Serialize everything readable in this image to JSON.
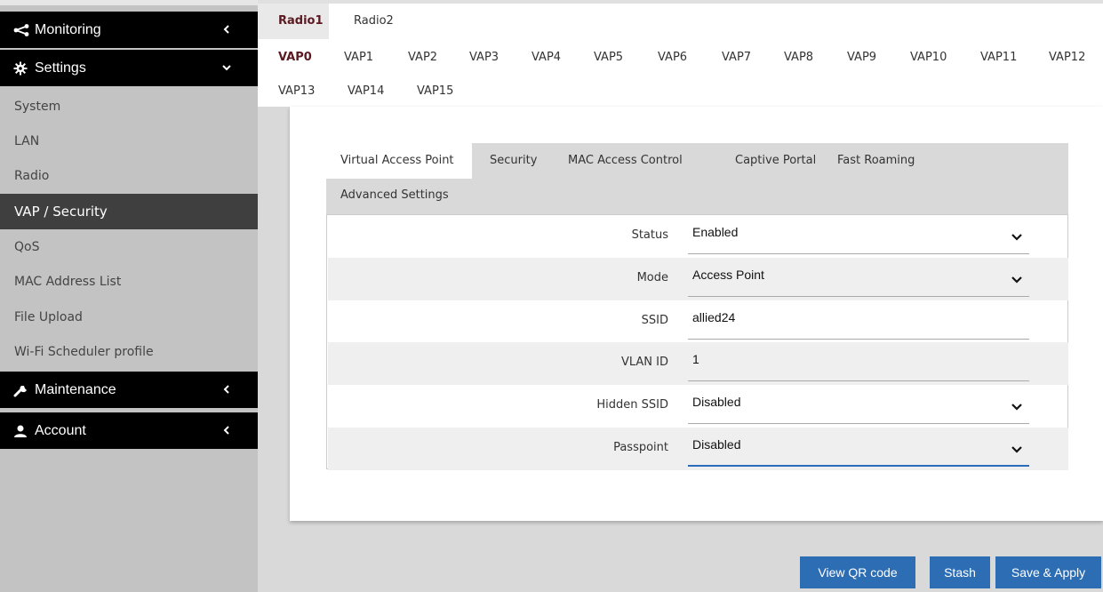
{
  "sidebar": {
    "monitoring": "Monitoring",
    "settings": "Settings",
    "items": [
      {
        "label": "System"
      },
      {
        "label": "LAN"
      },
      {
        "label": "Radio"
      },
      {
        "label": "VAP / Security"
      },
      {
        "label": "QoS"
      },
      {
        "label": "MAC Address List"
      },
      {
        "label": "File Upload"
      },
      {
        "label": "Wi-Fi Scheduler profile"
      }
    ],
    "maintenance": "Maintenance",
    "account": "Account"
  },
  "radio_tabs": [
    "Radio1",
    "Radio2"
  ],
  "vap_tabs": [
    "VAP0",
    "VAP1",
    "VAP2",
    "VAP3",
    "VAP4",
    "VAP5",
    "VAP6",
    "VAP7",
    "VAP8",
    "VAP9",
    "VAP10",
    "VAP11",
    "VAP12",
    "VAP13",
    "VAP14",
    "VAP15"
  ],
  "inner_tabs": [
    "Virtual Access Point",
    "Security",
    "MAC Access Control",
    "Captive Portal",
    "Fast Roaming",
    "Advanced Settings"
  ],
  "form": {
    "status": {
      "label": "Status",
      "value": "Enabled"
    },
    "mode": {
      "label": "Mode",
      "value": "Access Point"
    },
    "ssid": {
      "label": "SSID",
      "value": "allied24"
    },
    "vlan": {
      "label": "VLAN ID",
      "value": "1"
    },
    "hidden": {
      "label": "Hidden SSID",
      "value": "Disabled"
    },
    "passpoint": {
      "label": "Passpoint",
      "value": "Disabled"
    }
  },
  "buttons": {
    "qr": "View QR code",
    "stash": "Stash",
    "apply": "Save & Apply"
  },
  "colors": {
    "accent": "#2d6db4",
    "active_tab": "#5a1a22",
    "sidebar_bg": "#c3c3c3",
    "sidebar_active": "#3f3f3f"
  }
}
